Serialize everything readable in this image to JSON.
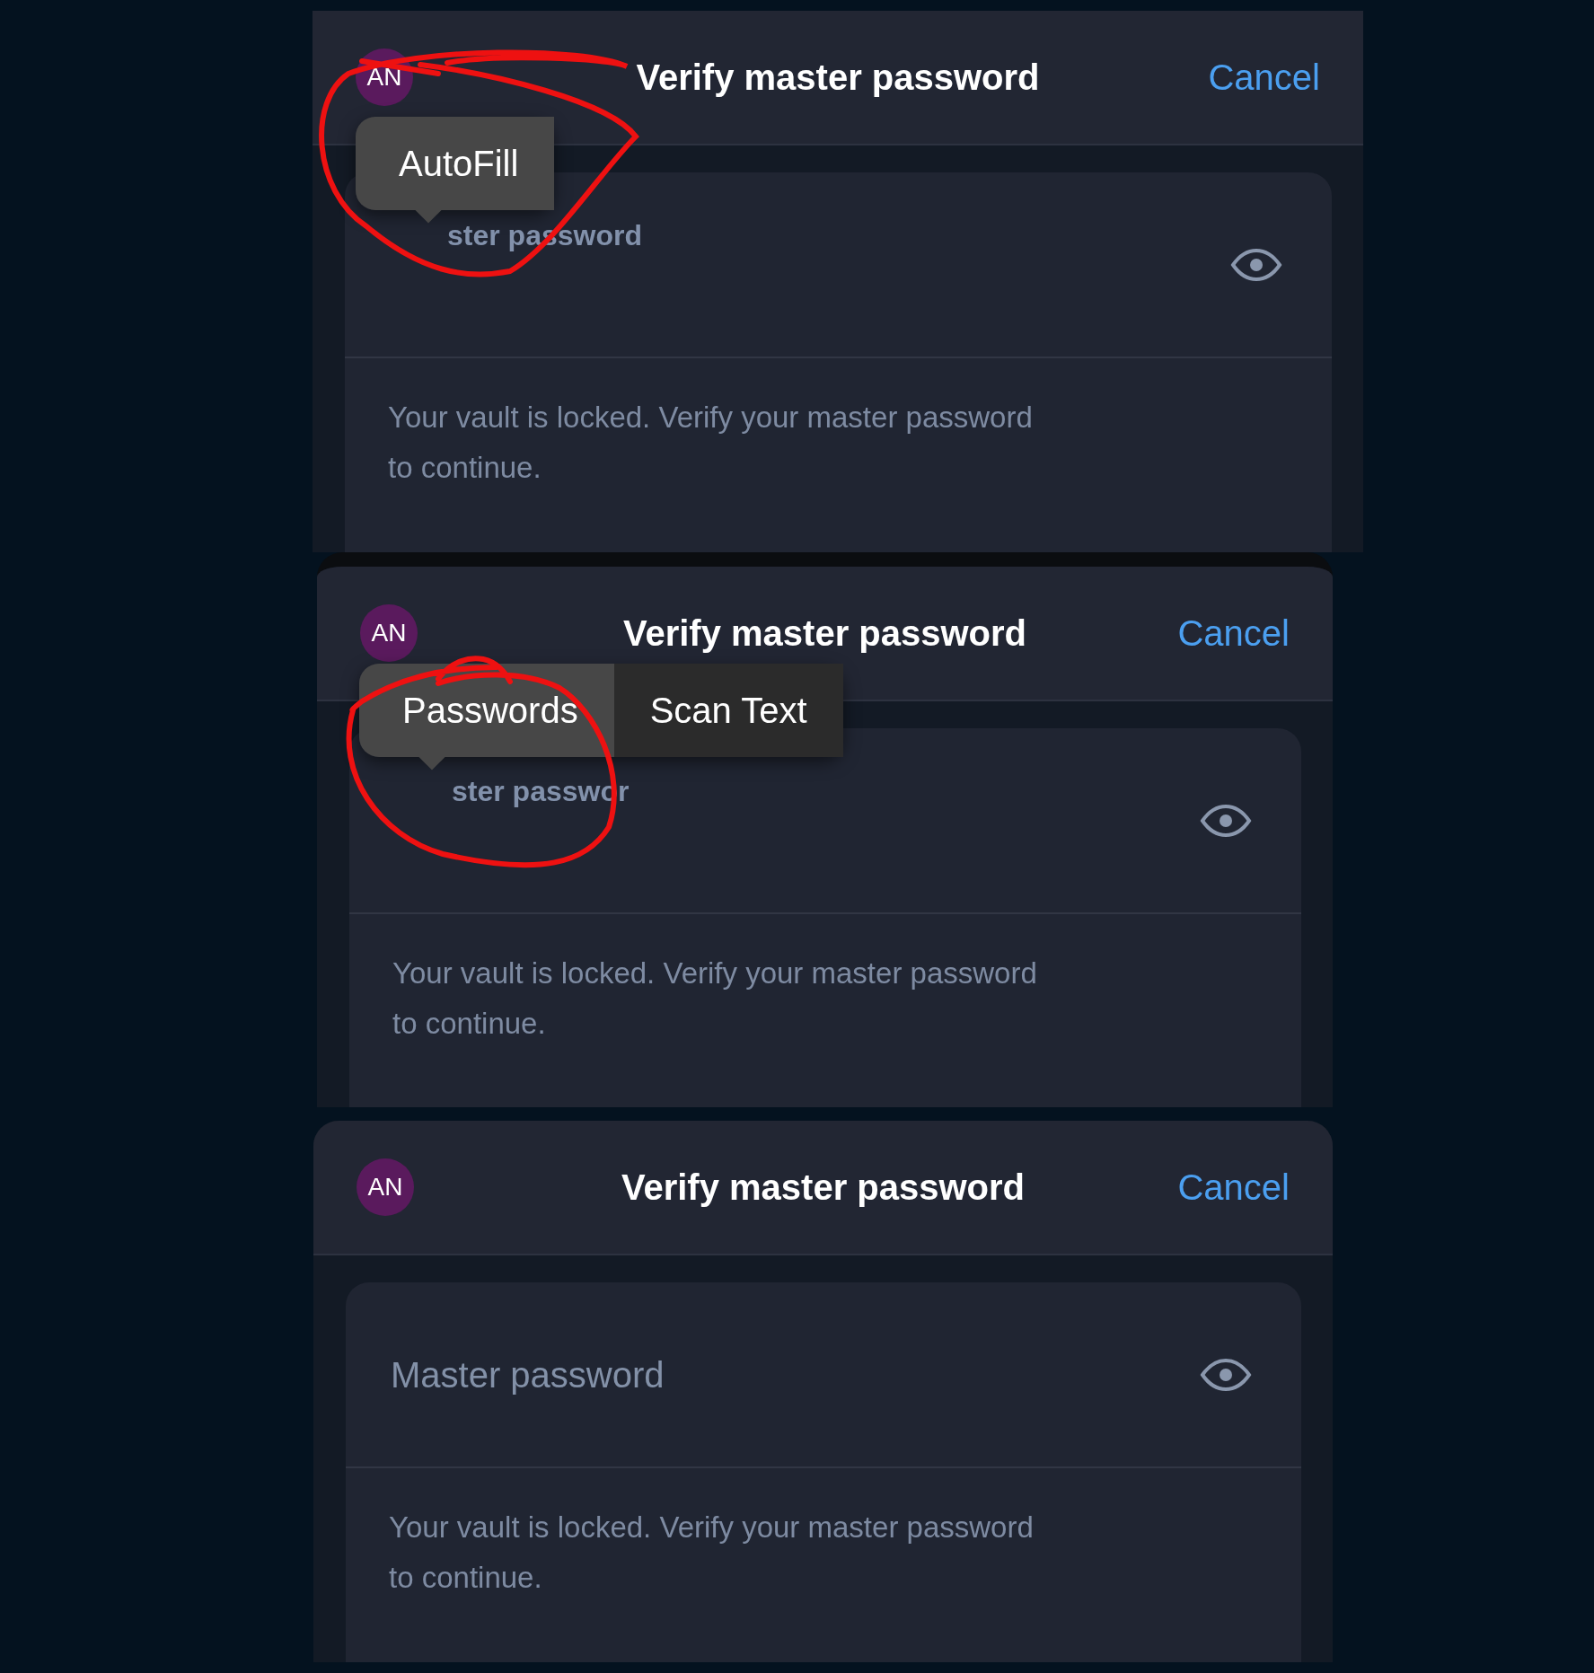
{
  "panels": [
    {
      "avatar": "AN",
      "title": "Verify master password",
      "cancel": "Cancel",
      "field": {
        "label": "ster password"
      },
      "message": "Your vault is locked. Verify your master password to continue.",
      "popover": {
        "circled": true,
        "items": [
          {
            "label": "AutoFill",
            "selected": true
          }
        ]
      }
    },
    {
      "avatar": "AN",
      "title": "Verify master password",
      "cancel": "Cancel",
      "field": {
        "label": "ster passwor"
      },
      "message": "Your vault is locked. Verify your master password to continue.",
      "popover": {
        "circled": true,
        "items": [
          {
            "label": "Passwords",
            "selected": true
          },
          {
            "label": "Scan Text",
            "selected": false
          }
        ]
      }
    },
    {
      "avatar": "AN",
      "title": "Verify master password",
      "cancel": "Cancel",
      "field": {
        "placeholder": "Master password"
      },
      "message": "Your vault is locked. Verify your master password to continue."
    }
  ]
}
